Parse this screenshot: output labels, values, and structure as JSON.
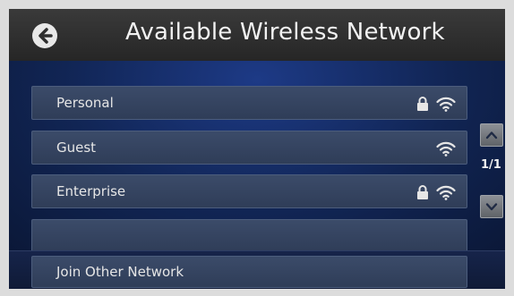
{
  "header": {
    "title": "Available Wireless Network",
    "back_icon": "back-arrow-icon"
  },
  "networks": [
    {
      "name": "Personal",
      "secured": true,
      "icons": [
        "lock-icon",
        "wifi-icon"
      ]
    },
    {
      "name": "Guest",
      "secured": false,
      "icons": [
        "wifi-icon"
      ]
    },
    {
      "name": "Enterprise",
      "secured": true,
      "icons": [
        "lock-icon",
        "wifi-icon"
      ]
    },
    {
      "name": "",
      "secured": false,
      "icons": []
    }
  ],
  "pager": {
    "indicator": "1/1",
    "up_icon": "chevron-up-icon",
    "down_icon": "chevron-down-icon"
  },
  "footer": {
    "join_label": "Join Other Network"
  },
  "colors": {
    "header_bg": "#2e2e2e",
    "content_bg": "#132a5f",
    "row_bg": "#35445f",
    "text": "#e6e6e6"
  }
}
